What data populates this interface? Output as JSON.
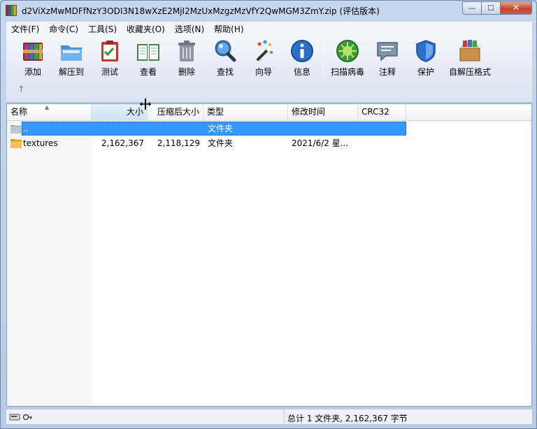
{
  "window": {
    "title": "d2ViXzMwMDFfNzY3ODI3N18wXzE2MjI2MzUxMzgzMzVfY2QwMGM3ZmY.zip (评估版本)",
    "minimize": "—",
    "maximize": "☐",
    "close": "✕"
  },
  "menu": [
    "文件(F)",
    "命令(C)",
    "工具(S)",
    "收藏夹(O)",
    "选项(N)",
    "帮助(H)"
  ],
  "toolbar": {
    "add": "添加",
    "extract": "解压到",
    "test": "测试",
    "view": "查看",
    "delete": "删除",
    "find": "查找",
    "wizard": "向导",
    "info": "信息",
    "scan": "扫描病毒",
    "comment": "注释",
    "protect": "保护",
    "sfx": "自解压格式",
    "up": "↑"
  },
  "columns": {
    "name": "名称",
    "size": "大小",
    "packed": "压缩后大小",
    "type": "类型",
    "modified": "修改时间",
    "crc": "CRC32"
  },
  "rows": [
    {
      "name": "..",
      "size": "",
      "packed": "",
      "type": "文件夹",
      "modified": "",
      "crc": ""
    },
    {
      "name": "textures",
      "size": "2,162,367",
      "packed": "2,118,129",
      "type": "文件夹",
      "modified": "2021/6/2 星...",
      "crc": ""
    }
  ],
  "status": {
    "summary": "总计 1 文件夹, 2,162,367 字节"
  },
  "colors": {
    "selection": "#3399ff",
    "folder": "#e8b341"
  }
}
